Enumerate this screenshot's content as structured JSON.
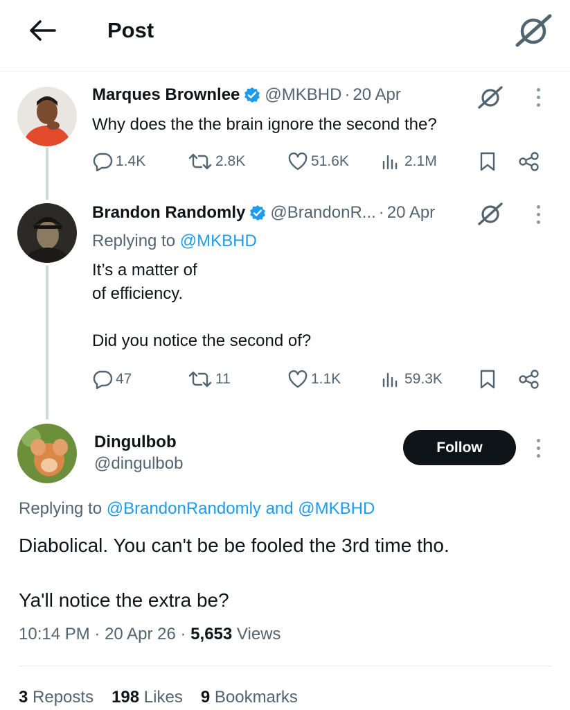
{
  "header": {
    "title": "Post"
  },
  "tweets": [
    {
      "name": "Marques Brownlee",
      "handle": "@MKBHD",
      "time": "20 Apr",
      "text_lines": [
        "Why does the the brain ignore the second the?"
      ],
      "replies": "1.4K",
      "reposts": "2.8K",
      "likes": "51.6K",
      "views": "2.1M"
    },
    {
      "name": "Brandon Randomly",
      "handle": "@BrandonR...",
      "time": "20 Apr",
      "replying_prefix": "Replying to",
      "replying_to": "@MKBHD",
      "text_lines": [
        "It’s a matter of",
        "of efficiency.",
        "",
        "Did you notice the second of?"
      ],
      "replies": "47",
      "reposts": "11",
      "likes": "1.1K",
      "views": "59.3K"
    }
  ],
  "main_post": {
    "name": "Dingulbob",
    "handle": "@dingulbob",
    "follow_label": "Follow",
    "replying_prefix": "Replying to",
    "replying_to_1": "@BrandonRandomly",
    "replying_and": "and",
    "replying_to_2": "@MKBHD",
    "text_line_1": "Diabolical. You can't be be fooled the 3rd time tho.",
    "text_line_2": "Ya'll notice the extra be?",
    "time": "10:14 PM",
    "date": "20 Apr 26",
    "views_count": "5,653",
    "views_label": "Views"
  },
  "stats": {
    "reposts_count": "3",
    "reposts_label": "Reposts",
    "likes_count": "198",
    "likes_label": "Likes",
    "bookmarks_count": "9",
    "bookmarks_label": "Bookmarks"
  },
  "icons": {
    "back": "arrow-left-icon",
    "grok": "grok-icon",
    "verified": "verified-badge-icon",
    "reply": "reply-icon",
    "repost": "repost-icon",
    "like": "heart-icon",
    "views": "views-icon",
    "bookmark": "bookmark-icon",
    "share": "share-icon",
    "more": "more-vertical-icon"
  },
  "colors": {
    "accent": "#1d9bf0",
    "text": "#0f1419",
    "muted": "#536471",
    "follow_bg": "#0f1419"
  }
}
